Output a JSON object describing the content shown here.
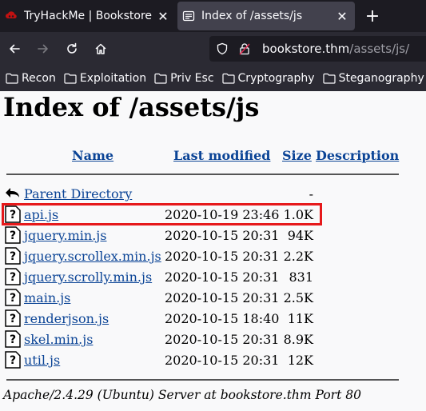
{
  "browser": {
    "tabs": [
      {
        "title": "TryHackMe | Bookstore",
        "favicon": "tryhackme-logo-icon",
        "active": false
      },
      {
        "title": "Index of /assets/js",
        "favicon": "folder-index-icon",
        "active": true
      }
    ],
    "url_host": "bookstore.thm",
    "url_path": "/assets/js/",
    "bookmarks": [
      "Recon",
      "Exploitation",
      "Priv Esc",
      "Cryptography",
      "Steganography"
    ],
    "colors": {
      "chrome_bg": "#1c1b22",
      "toolbar_bg": "#2b2a33",
      "active_tab": "#42414d"
    }
  },
  "page": {
    "title": "Index of /assets/js",
    "columns": {
      "name": "Name",
      "modified": "Last modified",
      "size": "Size",
      "description": "Description"
    },
    "parent": {
      "name": "Parent Directory",
      "size": "-"
    },
    "files": [
      {
        "name": "api.js",
        "modified": "2020-10-19 23:46",
        "size": "1.0K"
      },
      {
        "name": "jquery.min.js",
        "modified": "2020-10-15 20:31",
        "size": "94K"
      },
      {
        "name": "jquery.scrollex.min.js",
        "modified": "2020-10-15 20:31",
        "size": "2.2K"
      },
      {
        "name": "jquery.scrolly.min.js",
        "modified": "2020-10-15 20:31",
        "size": "831"
      },
      {
        "name": "main.js",
        "modified": "2020-10-15 20:31",
        "size": "2.5K"
      },
      {
        "name": "renderjson.js",
        "modified": "2020-10-15 18:40",
        "size": "11K"
      },
      {
        "name": "skel.min.js",
        "modified": "2020-10-15 20:31",
        "size": "8.9K"
      },
      {
        "name": "util.js",
        "modified": "2020-10-15 20:31",
        "size": "12K"
      }
    ],
    "footer": "Apache/2.4.29 (Ubuntu) Server at bookstore.thm Port 80",
    "highlight_color": "#e6191b",
    "link_color": "#0b4496"
  }
}
